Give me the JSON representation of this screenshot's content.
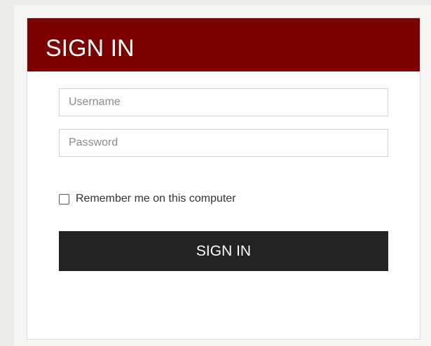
{
  "login": {
    "title": "SIGN IN",
    "username_placeholder": "Username",
    "password_placeholder": "Password",
    "remember_label": "Remember me on this computer",
    "remember_checked": false,
    "submit_label": "SIGN IN"
  },
  "colors": {
    "header_bg": "#7b0000",
    "button_bg": "#232323",
    "page_bg": "#ebebe7"
  }
}
